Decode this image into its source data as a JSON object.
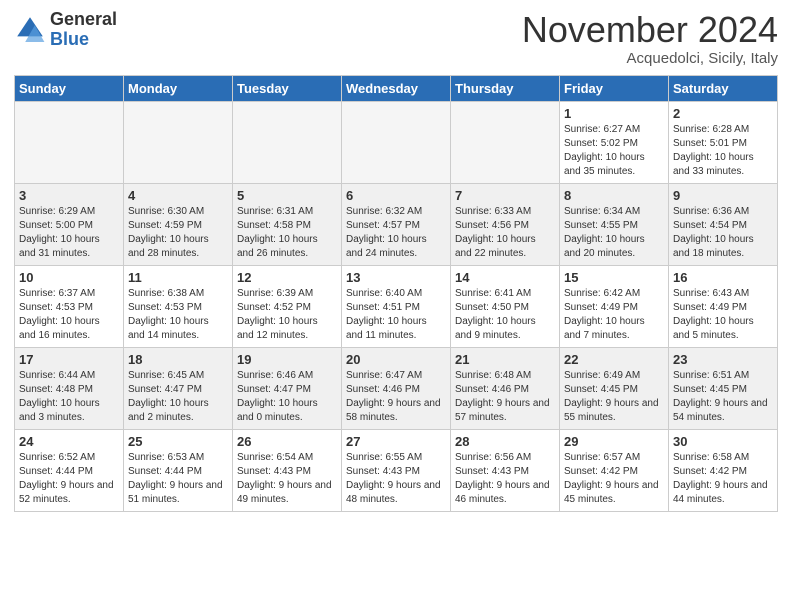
{
  "logo": {
    "general": "General",
    "blue": "Blue"
  },
  "header": {
    "month": "November 2024",
    "location": "Acquedolci, Sicily, Italy"
  },
  "weekdays": [
    "Sunday",
    "Monday",
    "Tuesday",
    "Wednesday",
    "Thursday",
    "Friday",
    "Saturday"
  ],
  "weeks": [
    [
      {
        "day": "",
        "info": ""
      },
      {
        "day": "",
        "info": ""
      },
      {
        "day": "",
        "info": ""
      },
      {
        "day": "",
        "info": ""
      },
      {
        "day": "",
        "info": ""
      },
      {
        "day": "1",
        "info": "Sunrise: 6:27 AM\nSunset: 5:02 PM\nDaylight: 10 hours and 35 minutes."
      },
      {
        "day": "2",
        "info": "Sunrise: 6:28 AM\nSunset: 5:01 PM\nDaylight: 10 hours and 33 minutes."
      }
    ],
    [
      {
        "day": "3",
        "info": "Sunrise: 6:29 AM\nSunset: 5:00 PM\nDaylight: 10 hours and 31 minutes."
      },
      {
        "day": "4",
        "info": "Sunrise: 6:30 AM\nSunset: 4:59 PM\nDaylight: 10 hours and 28 minutes."
      },
      {
        "day": "5",
        "info": "Sunrise: 6:31 AM\nSunset: 4:58 PM\nDaylight: 10 hours and 26 minutes."
      },
      {
        "day": "6",
        "info": "Sunrise: 6:32 AM\nSunset: 4:57 PM\nDaylight: 10 hours and 24 minutes."
      },
      {
        "day": "7",
        "info": "Sunrise: 6:33 AM\nSunset: 4:56 PM\nDaylight: 10 hours and 22 minutes."
      },
      {
        "day": "8",
        "info": "Sunrise: 6:34 AM\nSunset: 4:55 PM\nDaylight: 10 hours and 20 minutes."
      },
      {
        "day": "9",
        "info": "Sunrise: 6:36 AM\nSunset: 4:54 PM\nDaylight: 10 hours and 18 minutes."
      }
    ],
    [
      {
        "day": "10",
        "info": "Sunrise: 6:37 AM\nSunset: 4:53 PM\nDaylight: 10 hours and 16 minutes."
      },
      {
        "day": "11",
        "info": "Sunrise: 6:38 AM\nSunset: 4:53 PM\nDaylight: 10 hours and 14 minutes."
      },
      {
        "day": "12",
        "info": "Sunrise: 6:39 AM\nSunset: 4:52 PM\nDaylight: 10 hours and 12 minutes."
      },
      {
        "day": "13",
        "info": "Sunrise: 6:40 AM\nSunset: 4:51 PM\nDaylight: 10 hours and 11 minutes."
      },
      {
        "day": "14",
        "info": "Sunrise: 6:41 AM\nSunset: 4:50 PM\nDaylight: 10 hours and 9 minutes."
      },
      {
        "day": "15",
        "info": "Sunrise: 6:42 AM\nSunset: 4:49 PM\nDaylight: 10 hours and 7 minutes."
      },
      {
        "day": "16",
        "info": "Sunrise: 6:43 AM\nSunset: 4:49 PM\nDaylight: 10 hours and 5 minutes."
      }
    ],
    [
      {
        "day": "17",
        "info": "Sunrise: 6:44 AM\nSunset: 4:48 PM\nDaylight: 10 hours and 3 minutes."
      },
      {
        "day": "18",
        "info": "Sunrise: 6:45 AM\nSunset: 4:47 PM\nDaylight: 10 hours and 2 minutes."
      },
      {
        "day": "19",
        "info": "Sunrise: 6:46 AM\nSunset: 4:47 PM\nDaylight: 10 hours and 0 minutes."
      },
      {
        "day": "20",
        "info": "Sunrise: 6:47 AM\nSunset: 4:46 PM\nDaylight: 9 hours and 58 minutes."
      },
      {
        "day": "21",
        "info": "Sunrise: 6:48 AM\nSunset: 4:46 PM\nDaylight: 9 hours and 57 minutes."
      },
      {
        "day": "22",
        "info": "Sunrise: 6:49 AM\nSunset: 4:45 PM\nDaylight: 9 hours and 55 minutes."
      },
      {
        "day": "23",
        "info": "Sunrise: 6:51 AM\nSunset: 4:45 PM\nDaylight: 9 hours and 54 minutes."
      }
    ],
    [
      {
        "day": "24",
        "info": "Sunrise: 6:52 AM\nSunset: 4:44 PM\nDaylight: 9 hours and 52 minutes."
      },
      {
        "day": "25",
        "info": "Sunrise: 6:53 AM\nSunset: 4:44 PM\nDaylight: 9 hours and 51 minutes."
      },
      {
        "day": "26",
        "info": "Sunrise: 6:54 AM\nSunset: 4:43 PM\nDaylight: 9 hours and 49 minutes."
      },
      {
        "day": "27",
        "info": "Sunrise: 6:55 AM\nSunset: 4:43 PM\nDaylight: 9 hours and 48 minutes."
      },
      {
        "day": "28",
        "info": "Sunrise: 6:56 AM\nSunset: 4:43 PM\nDaylight: 9 hours and 46 minutes."
      },
      {
        "day": "29",
        "info": "Sunrise: 6:57 AM\nSunset: 4:42 PM\nDaylight: 9 hours and 45 minutes."
      },
      {
        "day": "30",
        "info": "Sunrise: 6:58 AM\nSunset: 4:42 PM\nDaylight: 9 hours and 44 minutes."
      }
    ]
  ]
}
